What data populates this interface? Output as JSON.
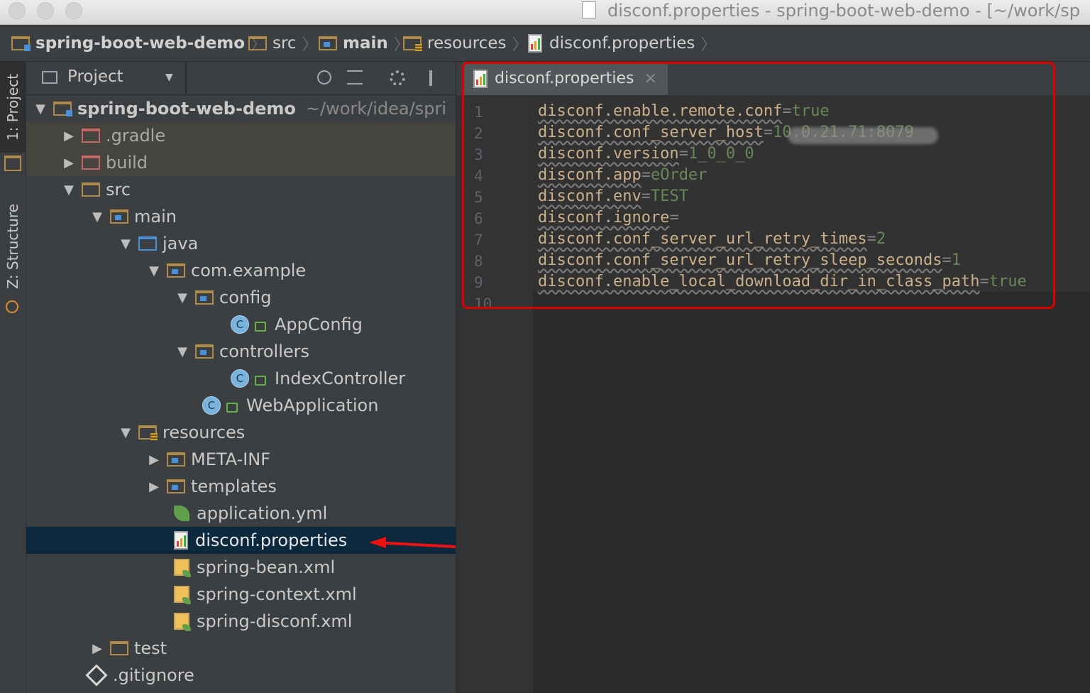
{
  "window": {
    "title": "disconf.properties - spring-boot-web-demo - [~/work/sp"
  },
  "breadcrumb": [
    "spring-boot-web-demo",
    "src",
    "main",
    "resources",
    "disconf.properties"
  ],
  "tool_windows": {
    "project_tab": "1: Project",
    "structure_tab": "Z: Structure"
  },
  "project_panel": {
    "view_label": "Project",
    "tree": [
      {
        "label": "spring-boot-web-demo",
        "path_hint": "~/work/idea/spri"
      },
      {
        "label": ".gradle"
      },
      {
        "label": "build"
      },
      {
        "label": "src"
      },
      {
        "label": "main"
      },
      {
        "label": "java"
      },
      {
        "label": "com.example"
      },
      {
        "label": "config"
      },
      {
        "label": "AppConfig"
      },
      {
        "label": "controllers"
      },
      {
        "label": "IndexController"
      },
      {
        "label": "WebApplication"
      },
      {
        "label": "resources"
      },
      {
        "label": "META-INF"
      },
      {
        "label": "templates"
      },
      {
        "label": "application.yml"
      },
      {
        "label": "disconf.properties"
      },
      {
        "label": "spring-bean.xml"
      },
      {
        "label": "spring-context.xml"
      },
      {
        "label": "spring-disconf.xml"
      },
      {
        "label": "test"
      },
      {
        "label": ".gitignore"
      }
    ]
  },
  "editor": {
    "tab_label": "disconf.properties",
    "close_glyph": "×",
    "line_numbers": [
      "1",
      "2",
      "3",
      "4",
      "5",
      "6",
      "7",
      "8",
      "9",
      "10"
    ],
    "lines": [
      {
        "key": "disconf.enable.remote.conf",
        "value": "true"
      },
      {
        "key": "disconf.conf_server_host",
        "value": "10.0.21.71:8079"
      },
      {
        "key": "disconf.version",
        "value": "1_0_0_0"
      },
      {
        "key": "disconf.app",
        "value": "eOrder"
      },
      {
        "key": "disconf.env",
        "value": "TEST"
      },
      {
        "key": "disconf.ignore",
        "value": ""
      },
      {
        "key": "disconf.conf_server_url_retry_times",
        "value": "2"
      },
      {
        "key": "disconf.conf_server_url_retry_sleep_seconds",
        "value": "1"
      },
      {
        "key": "disconf.enable_local_download_dir_in_class_path",
        "value": "true"
      }
    ],
    "equals": "="
  },
  "glyphs": {
    "sep": "〉",
    "expanded": "▼",
    "collapsed": "▶",
    "class_letter": "C",
    "dropdown": "▼"
  }
}
